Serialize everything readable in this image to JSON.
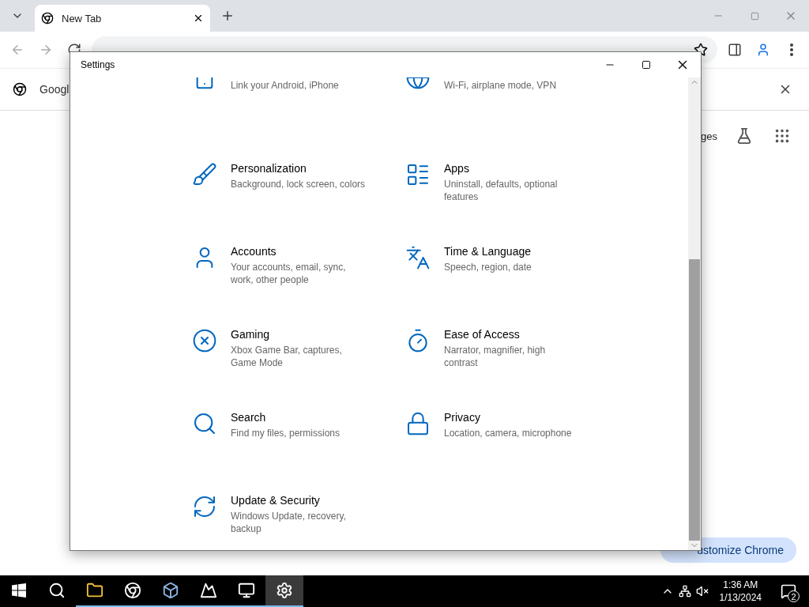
{
  "browser": {
    "tabs": [
      {
        "label": "New Tab",
        "selected": true
      }
    ],
    "banner": {
      "text": "Googl"
    },
    "page": {
      "header_link": "ges",
      "customize_button": "ustomize Chrome"
    }
  },
  "settings": {
    "title": "Settings",
    "items": [
      {
        "kind": "phone",
        "description": "Link your Android, iPhone"
      },
      {
        "kind": "network",
        "description": "Wi-Fi, airplane mode, VPN"
      },
      {
        "kind": "personalization",
        "title": "Personalization",
        "description": "Background, lock screen, colors"
      },
      {
        "kind": "apps",
        "title": "Apps",
        "description": "Uninstall, defaults, optional features"
      },
      {
        "kind": "accounts",
        "title": "Accounts",
        "description": "Your accounts, email, sync, work, other people"
      },
      {
        "kind": "time",
        "title": "Time & Language",
        "description": "Speech, region, date"
      },
      {
        "kind": "gaming",
        "title": "Gaming",
        "description": "Xbox Game Bar, captures, Game Mode"
      },
      {
        "kind": "ease",
        "title": "Ease of Access",
        "description": "Narrator, magnifier, high contrast"
      },
      {
        "kind": "search",
        "title": "Search",
        "description": "Find my files, permissions"
      },
      {
        "kind": "privacy",
        "title": "Privacy",
        "description": "Location, camera, microphone"
      },
      {
        "kind": "update",
        "title": "Update & Security",
        "description": "Windows Update, recovery, backup"
      }
    ]
  },
  "taskbar": {
    "apps": [
      {
        "kind": "folder",
        "selected": false,
        "open": true
      },
      {
        "kind": "chrome",
        "selected": false,
        "open": true
      },
      {
        "kind": "cube",
        "selected": false,
        "open": true
      },
      {
        "kind": "drawing",
        "selected": false,
        "open": true
      },
      {
        "kind": "monitor",
        "selected": false,
        "open": true
      },
      {
        "kind": "gear",
        "selected": true,
        "open": true
      }
    ],
    "time": "1:36 AM",
    "date": "1/13/2024",
    "notifications": "2"
  }
}
